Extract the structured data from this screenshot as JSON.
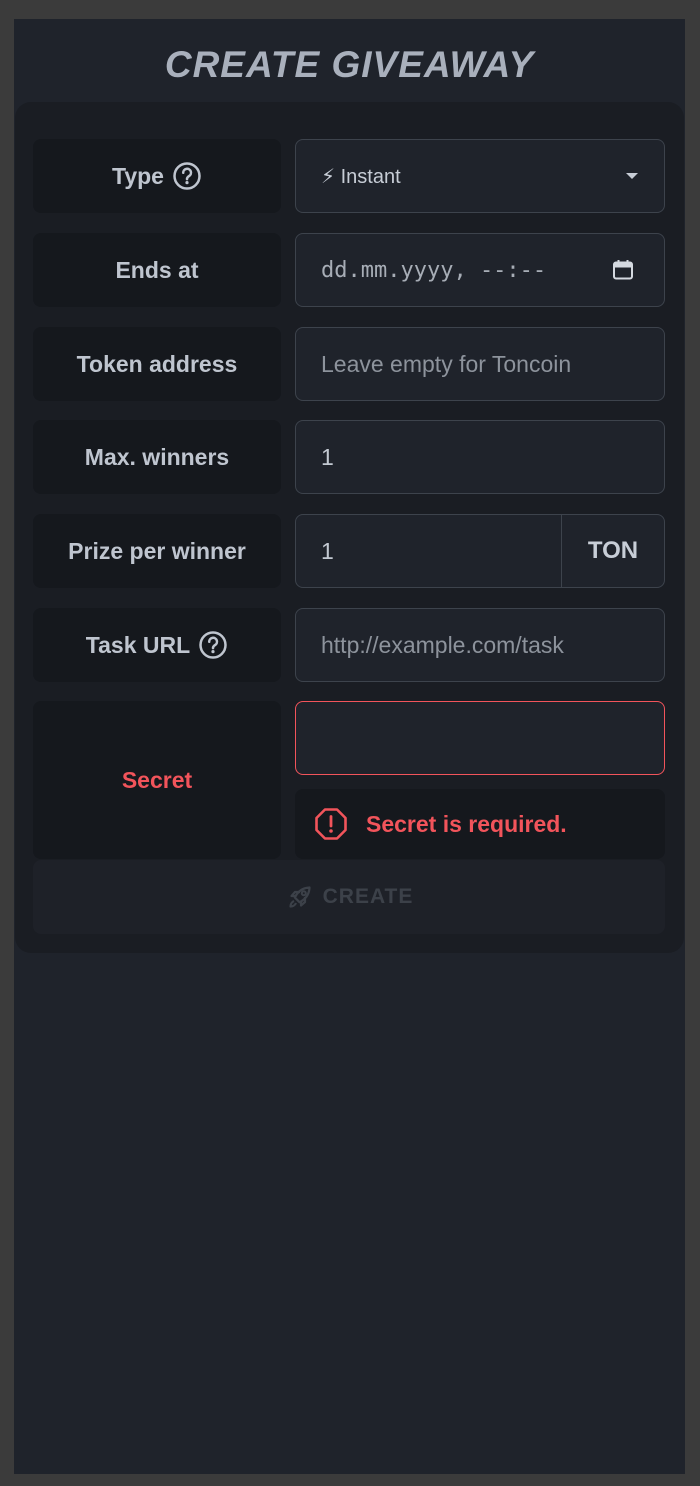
{
  "page": {
    "title": "CREATE GIVEAWAY"
  },
  "form": {
    "type": {
      "label": "Type",
      "value": "⚡ Instant"
    },
    "ends_at": {
      "label": "Ends at",
      "placeholder": "dd.mm.yyyy, --:--"
    },
    "token_address": {
      "label": "Token address",
      "placeholder": "Leave empty for Toncoin"
    },
    "max_winners": {
      "label": "Max. winners",
      "value": "1"
    },
    "prize_per_winner": {
      "label": "Prize per winner",
      "value": "1",
      "unit": "TON"
    },
    "task_url": {
      "label": "Task URL",
      "placeholder": "http://example.com/task"
    },
    "secret": {
      "label": "Secret",
      "value": "",
      "error": "Secret is required."
    },
    "submit_label": "CREATE"
  },
  "colors": {
    "background": "#1f232b",
    "card": "#1a1d23",
    "label_bg": "#15181d",
    "error": "#f2545b",
    "text": "#bfc5cf",
    "disabled_text": "#3c4149"
  },
  "icons": {
    "help": "question-circle-icon",
    "calendar": "calendar-icon",
    "error": "octagon-exclamation-icon",
    "submit": "rocket-icon",
    "dropdown": "caret-down-icon"
  }
}
